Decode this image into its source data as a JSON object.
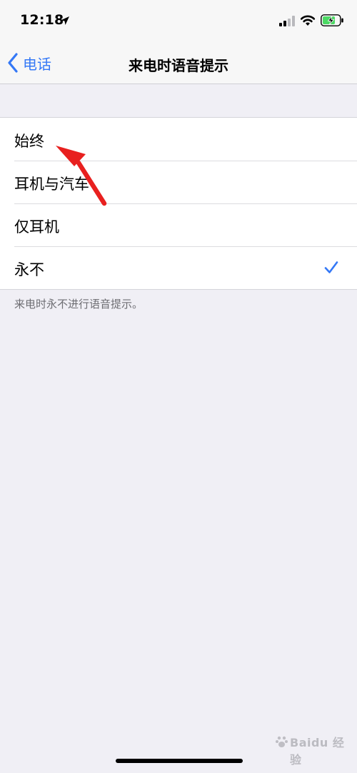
{
  "status_bar": {
    "time": "12:18",
    "icons": [
      "location-arrow-icon",
      "cellular-signal-icon",
      "wifi-icon",
      "battery-charging-icon"
    ]
  },
  "nav": {
    "back_label": "电话",
    "title": "来电时语音提示"
  },
  "options": [
    {
      "label": "始终",
      "selected": false
    },
    {
      "label": "耳机与汽车",
      "selected": false
    },
    {
      "label": "仅耳机",
      "selected": false
    },
    {
      "label": "永不",
      "selected": true
    }
  ],
  "footer_note": "来电时永不进行语音提示。",
  "watermark_text": "Baidu 经验",
  "colors": {
    "accent": "#3478f6",
    "annotation": "#e8201f",
    "battery": "#4cd964",
    "background": "#f0eff5"
  }
}
